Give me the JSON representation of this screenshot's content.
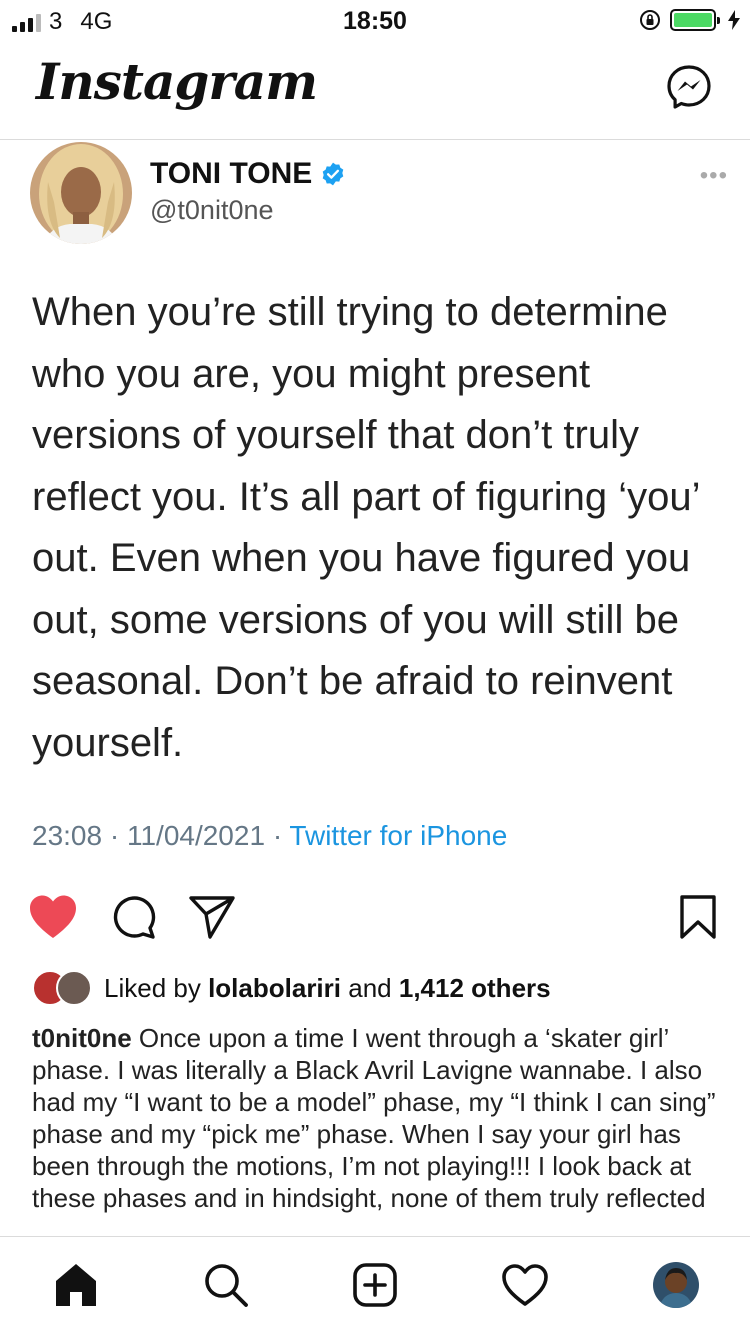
{
  "status_bar": {
    "carrier": "3",
    "network": "4G",
    "time": "18:50"
  },
  "header": {
    "logo": "Instagram",
    "messenger_icon": "messenger-icon"
  },
  "tweet": {
    "author_name": "TONI TONE",
    "verified_icon": "verified-badge-icon",
    "handle": "@t0nit0ne",
    "more_icon": "more-dots-icon",
    "text": "When you’re still trying to determine who you are, you might present versions of yourself that don’t truly reflect you. It’s all part of figuring ‘you’ out. Even when you have figured you out, some versions of you will still be seasonal. Don’t be afraid to reinvent yourself.",
    "time": "23:08",
    "date": "11/04/2021",
    "separator": "·",
    "source": "Twitter for iPhone"
  },
  "actions": {
    "like_icon": "heart-filled-icon",
    "comment_icon": "comment-icon",
    "share_icon": "send-icon",
    "save_icon": "bookmark-icon",
    "like_color": "#ed4956"
  },
  "likes": {
    "prefix": "Liked by",
    "user": "lolabolariri",
    "connector": "and",
    "others": "1,412 others"
  },
  "caption": {
    "username": "t0nit0ne",
    "text": "Once upon a time I went through a ‘skater girl’ phase. I was literally a Black Avril Lavigne wannabe. I also had my “I want to be a model” phase, my “I think I can sing” phase and my “pick me” phase. When I say your girl has been through the motions, I’m not playing!!! I look back at these phases and in hindsight, none of them truly reflected"
  },
  "bottom_nav": {
    "items": [
      "home-icon",
      "search-icon",
      "new-post-icon",
      "activity-heart-icon",
      "profile-avatar"
    ]
  }
}
